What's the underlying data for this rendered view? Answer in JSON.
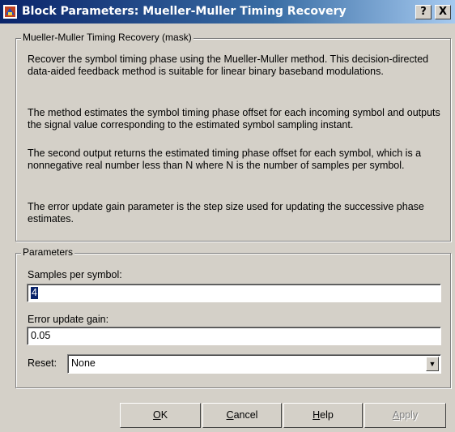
{
  "window": {
    "title": "Block Parameters: Mueller-Muller Timing Recovery",
    "help_button": "?",
    "close_button": "X"
  },
  "mask": {
    "legend": "Mueller-Muller Timing Recovery (mask)",
    "paragraphs": [
      "Recover the symbol timing phase using the Mueller-Muller method. This decision-directed data-aided feedback method is suitable for linear binary baseband modulations.",
      "The method estimates the symbol timing phase offset for each incoming symbol and outputs the signal value corresponding to the estimated symbol sampling instant.",
      "The second output returns the estimated timing phase offset for each symbol, which is a nonnegative real number less than N where N is the number of samples per symbol.",
      "The error update gain parameter is the step size used for updating the successive phase estimates."
    ]
  },
  "parameters": {
    "legend": "Parameters",
    "samples_label": "Samples per symbol:",
    "samples_value": "4",
    "gain_label": "Error update gain:",
    "gain_value": "0.05",
    "reset_label": "Reset:",
    "reset_value": "None"
  },
  "buttons": {
    "ok": {
      "mnemonic": "O",
      "rest": "K"
    },
    "cancel": {
      "mnemonic": "C",
      "rest": "ancel"
    },
    "help": {
      "mnemonic": "H",
      "rest": "elp"
    },
    "apply": {
      "mnemonic": "A",
      "rest": "pply"
    }
  },
  "colors": {
    "titlebar_start": "#0a246a",
    "titlebar_end": "#a6caf0",
    "dialog_face": "#d4d0c8"
  }
}
